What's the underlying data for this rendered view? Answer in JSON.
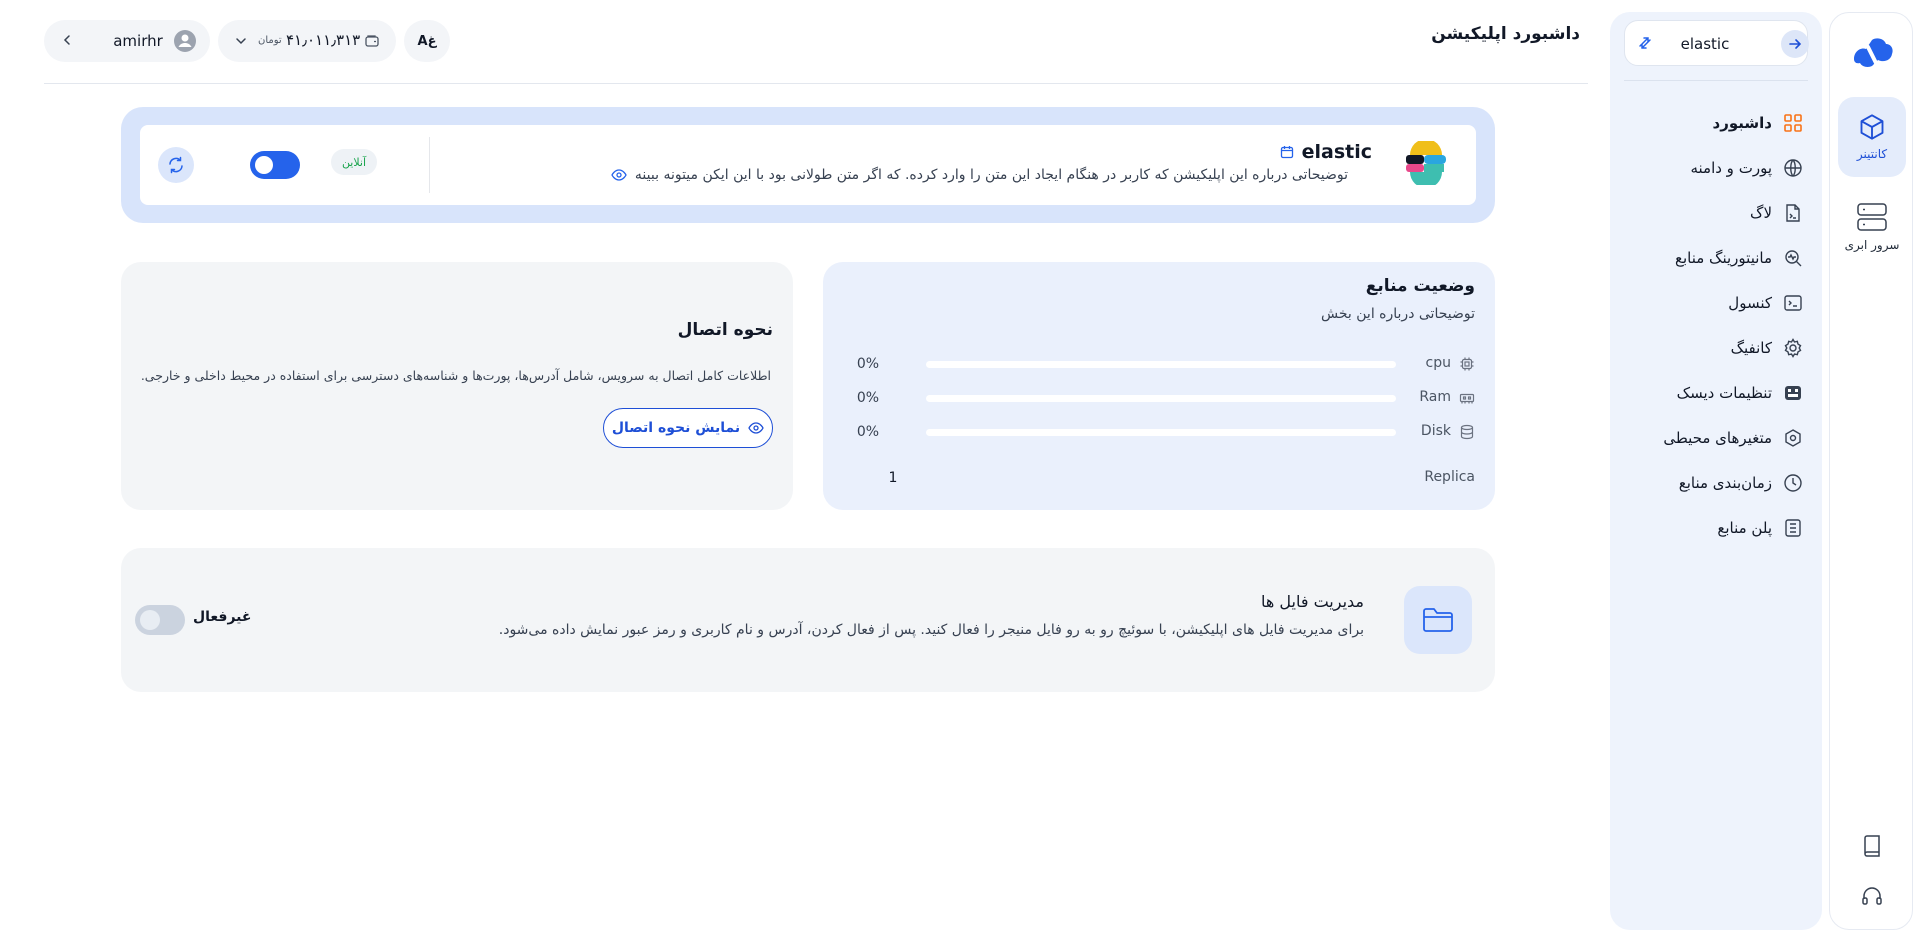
{
  "header": {
    "page_title": "داشبورد اپلیکیشن",
    "username": "amirhr",
    "balance": "۴۱٫۰۱۱٫۳۱۳",
    "currency": "تومان",
    "lang_label": "Aغ"
  },
  "rail": {
    "items": [
      {
        "label": "کانتینر",
        "icon": "cube-icon",
        "active": true
      },
      {
        "label": "سرور ابری",
        "icon": "server-icon",
        "active": false
      }
    ],
    "bottom": [
      {
        "icon": "book-icon"
      },
      {
        "icon": "headset-icon"
      }
    ]
  },
  "sidebar": {
    "current_app": "elastic",
    "items": [
      {
        "label": "داشبورد",
        "icon": "grid-icon",
        "active": true
      },
      {
        "label": "پورت و دامنه",
        "icon": "globe-icon"
      },
      {
        "label": "لاگ",
        "icon": "file-log-icon"
      },
      {
        "label": "مانیتورینگ منابع",
        "icon": "monitor-search-icon"
      },
      {
        "label": "کنسول",
        "icon": "terminal-icon"
      },
      {
        "label": "کانفیگ",
        "icon": "gear-icon"
      },
      {
        "label": "تنظیمات دیسک",
        "icon": "disk-icon"
      },
      {
        "label": "متغیرهای محیطی",
        "icon": "hexagon-icon"
      },
      {
        "label": "زمان‌بندی منابع",
        "icon": "clock-icon"
      },
      {
        "label": "پلن منابع",
        "icon": "list-icon"
      }
    ]
  },
  "app": {
    "name": "elastic",
    "description": "توضیحاتی درباره این اپلیکیشن که کاربر در هنگام ایجاد این متن را وارد کرده. که اگر متن طولانی بود با این ایکن میتونه ببینه",
    "status": "آنلاین",
    "enabled": true,
    "colors": {
      "accent": "#2563eb",
      "online": "#16a34a"
    }
  },
  "resources": {
    "title": "وضعیت منابع",
    "description": "توضیحاتی درباره این بخش",
    "rows": [
      {
        "name": "cpu",
        "icon": "cpu-icon",
        "value": "0%",
        "fraction": 0
      },
      {
        "name": "Ram",
        "icon": "ram-icon",
        "value": "0%",
        "fraction": 0
      },
      {
        "name": "Disk",
        "icon": "database-icon",
        "value": "0%",
        "fraction": 0
      }
    ],
    "replica_label": "Replica",
    "replica_value": "1"
  },
  "connection": {
    "title": "نحوه اتصال",
    "description": "اطلاعات کامل اتصال به سرویس، شامل آدرس‌ها، پورت‌ها و شناسه‌های دسترسی برای استفاده در محیط داخلی و خارجی.",
    "button_label": "نمایش نحوه اتصال"
  },
  "file_manager": {
    "title": "مدیریت فایل ها",
    "description": "برای مدیریت فایل های اپلیکیشن، با سوئیچ رو به رو فایل منیجر را فعال کنید. پس از فعال کردن، آدرس و نام کاربری و رمز عبور نمایش داده می‌شود.",
    "status": "غیرفعال",
    "enabled": false
  }
}
